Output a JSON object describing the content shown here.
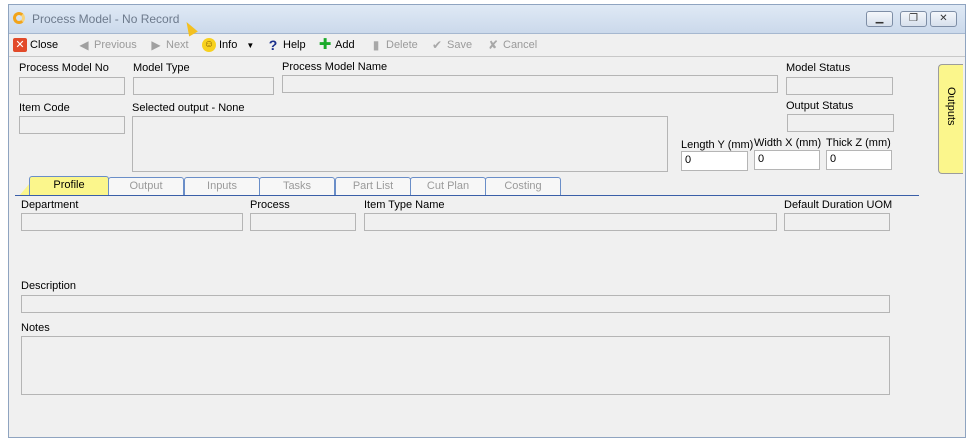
{
  "window": {
    "title": "Process Model - No Record"
  },
  "toolbar": {
    "close": "Close",
    "previous": "Previous",
    "next": "Next",
    "info": "Info",
    "help": "Help",
    "add": "Add",
    "delete": "Delete",
    "save": "Save",
    "cancel": "Cancel"
  },
  "header": {
    "process_model_no": "Process Model No",
    "model_type": "Model Type",
    "process_model_name": "Process Model Name",
    "model_status": "Model Status",
    "item_code": "Item Code",
    "selected_output": "Selected output - None",
    "output_status": "Output Status",
    "length_label": "Length Y (mm)",
    "width_label": "Width X (mm)",
    "thick_label": "Thick Z (mm)",
    "length_value": "0",
    "width_value": "0",
    "thick_value": "0"
  },
  "side_tab": {
    "label": "Outputs"
  },
  "tabs": [
    "Profile",
    "Output",
    "Inputs",
    "Tasks",
    "Part List",
    "Cut Plan",
    "Costing"
  ],
  "profile": {
    "department": "Department",
    "process": "Process",
    "item_type_name": "Item Type Name",
    "default_duration_uom": "Default Duration UOM",
    "description": "Description",
    "notes": "Notes"
  },
  "colors": {
    "accent_tab": "#fbf68c",
    "tab_border": "#3a5fa8",
    "window_bg": "#f0f0f0"
  }
}
